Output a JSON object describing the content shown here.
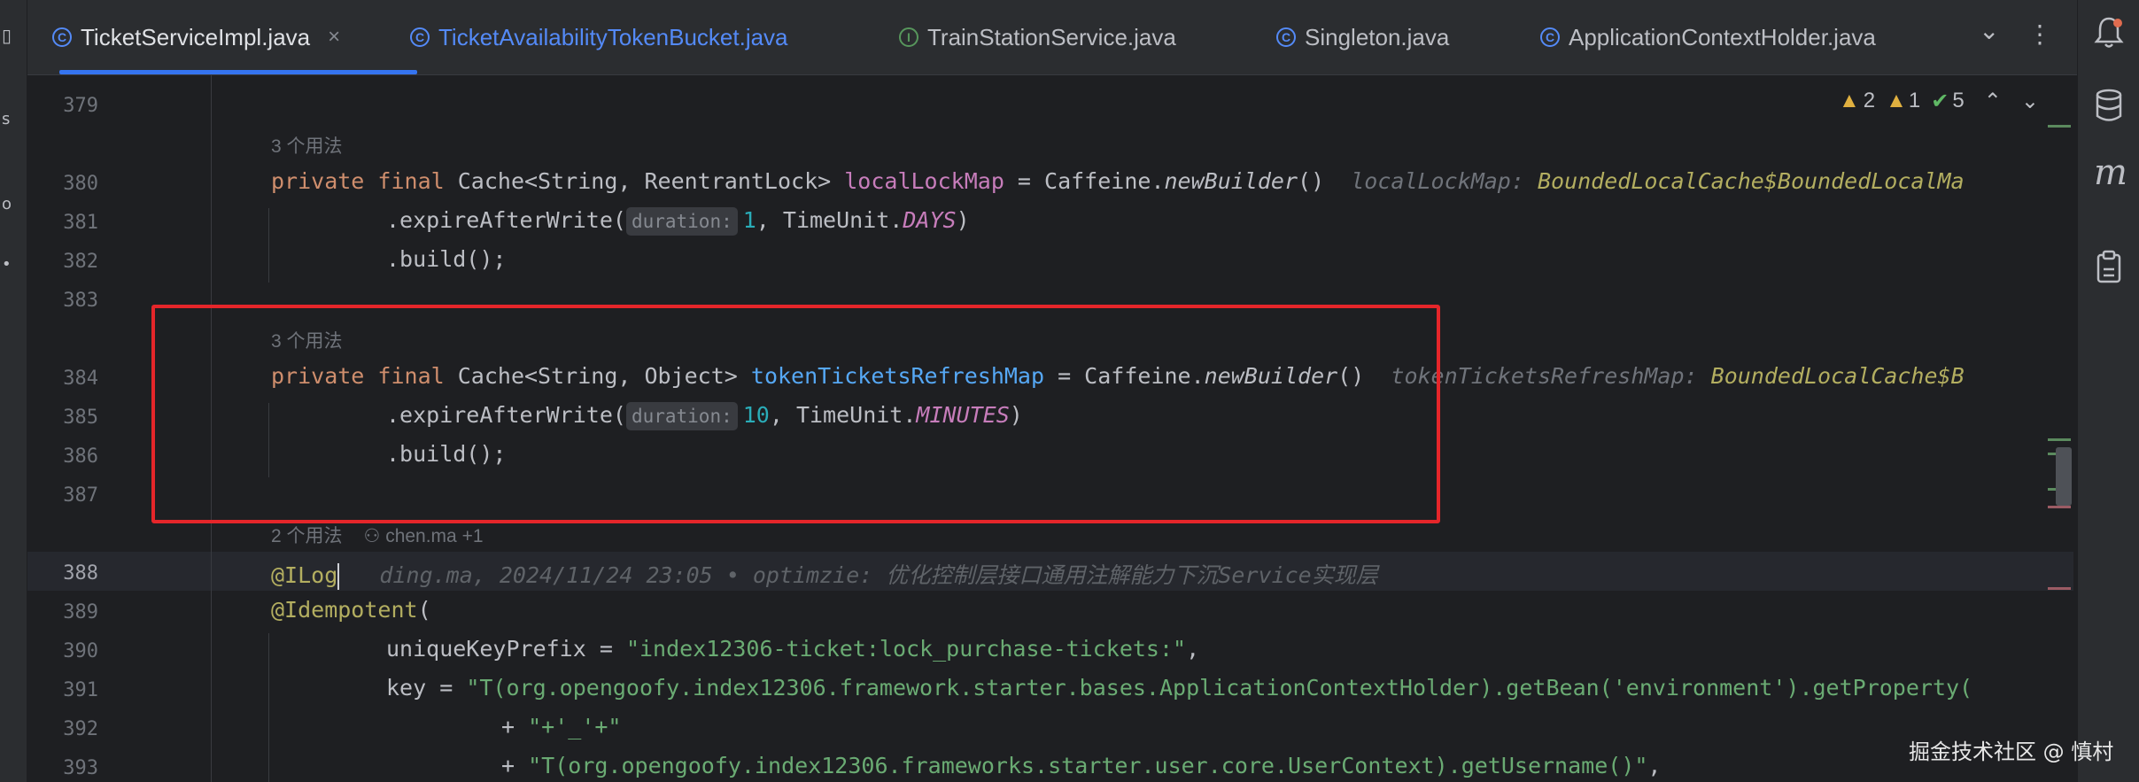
{
  "tabs": [
    {
      "label": "TicketServiceImpl.java",
      "icon": "class-icon",
      "active": true
    },
    {
      "label": "TicketAvailabilityTokenBucket.java",
      "icon": "class-icon",
      "active": false
    },
    {
      "label": "TrainStationService.java",
      "icon": "interface-icon",
      "active": false
    },
    {
      "label": "Singleton.java",
      "icon": "class-icon",
      "active": false
    },
    {
      "label": "ApplicationContextHolder.java",
      "icon": "class-icon",
      "active": false
    }
  ],
  "tab_close": "×",
  "tab_overflow": "⌄",
  "tab_menu": "⋮",
  "inspections": {
    "warnings": "2",
    "weak": "1",
    "ok": "5"
  },
  "line_numbers": [
    "379",
    "380",
    "381",
    "382",
    "383",
    "384",
    "385",
    "386",
    "387",
    "388",
    "389",
    "390",
    "391",
    "392",
    "393"
  ],
  "usages": {
    "u1": "3 个用法",
    "u2": "3 个用法",
    "u3": "2 个用法",
    "u3_author": "chen.ma +1"
  },
  "code": {
    "l380": {
      "kw1": "private",
      "kw2": "final",
      "type": "Cache<String, ReentrantLock>",
      "field": "localLockMap",
      "rest1": " = Caffeine.",
      "method": "newBuilder",
      "rest2": "()",
      "inlay_name": "localLockMap:",
      "inlay_type": "BoundedLocalCache$BoundedLocalMa"
    },
    "l381": {
      "pre": ".expireAfterWrite(",
      "hint": "duration:",
      "num": "1",
      "mid": ", TimeUnit.",
      "cst": "DAYS",
      "post": ")"
    },
    "l382": {
      "text": ".build();"
    },
    "l384": {
      "kw1": "private",
      "kw2": "final",
      "type": "Cache<String, Object>",
      "field": "tokenTicketsRefreshMap",
      "rest1": " = Caffeine.",
      "method": "newBuilder",
      "rest2": "()",
      "inlay_name": "tokenTicketsRefreshMap:",
      "inlay_type": "BoundedLocalCache$B"
    },
    "l385": {
      "pre": ".expireAfterWrite(",
      "hint": "duration:",
      "num": "10",
      "mid": ", TimeUnit.",
      "cst": "MINUTES",
      "post": ")"
    },
    "l386": {
      "text": ".build();"
    },
    "l388": {
      "ann": "@ILog",
      "blame": "ding.ma, 2024/11/24 23:05 • optimzie: 优化控制层接口通用注解能力下沉Service实现层"
    },
    "l389": {
      "ann": "@Idempotent",
      "rest": "("
    },
    "l390": {
      "pre": "uniqueKeyPrefix = ",
      "str": "\"index12306-ticket:lock_purchase-tickets:\"",
      "post": ","
    },
    "l391": {
      "pre": "key = ",
      "str": "\"T(org.opengoofy.index12306.framework.starter.bases.ApplicationContextHolder).getBean('environment').getProperty("
    },
    "l392": {
      "pre": "+ ",
      "str": "\"+'_'+\""
    },
    "l393": {
      "pre": "+ ",
      "str": "\"T(org.opengoofy.index12306.frameworks.starter.user.core.UserContext).getUsername()\"",
      "post": ","
    }
  },
  "watermark": "掘金技术社区 @ 慎村",
  "colors": {
    "highlight_box": "#e5262a",
    "tab_accent": "#3574f0"
  }
}
